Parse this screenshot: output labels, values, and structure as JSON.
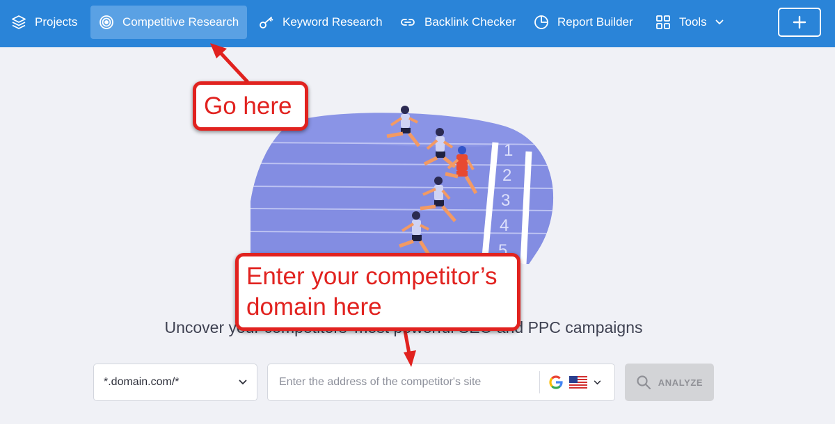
{
  "nav": {
    "items": [
      {
        "label": "Projects",
        "icon": "layers-icon"
      },
      {
        "label": "Competitive Research",
        "icon": "target-icon",
        "active": true
      },
      {
        "label": "Keyword Research",
        "icon": "key-icon"
      },
      {
        "label": "Backlink Checker",
        "icon": "link-icon"
      },
      {
        "label": "Report Builder",
        "icon": "pie-chart-icon"
      },
      {
        "label": "Tools",
        "icon": "grid-icon",
        "dropdown": true
      }
    ],
    "add_button_icon": "plus-icon",
    "bar_color": "#2a84d8",
    "active_color": "#5aa1e4"
  },
  "hero": {
    "headline": "Uncover your competitors' most powerful SEO and PPC campaigns",
    "illustration": "runners-on-track-illustration",
    "lane_numbers": [
      "1",
      "2",
      "3",
      "4",
      "5"
    ]
  },
  "search": {
    "scope_value": "*.domain.com/*",
    "url_placeholder": "Enter the address of the competitor's site",
    "search_engine_icon": "google-icon",
    "country_icon": "us-flag-icon",
    "analyze_label": "ANALYZE"
  },
  "annotations": {
    "callout_1": "Go here",
    "callout_2": "Enter your competitor’s domain here",
    "color": "#e1221f"
  }
}
